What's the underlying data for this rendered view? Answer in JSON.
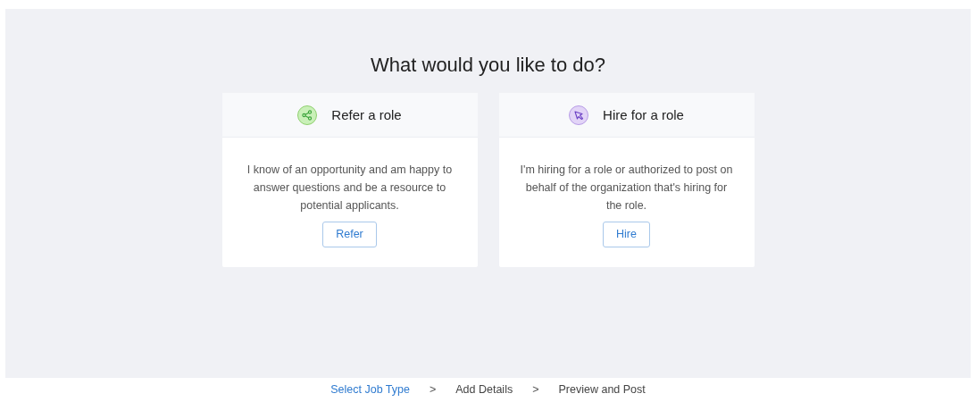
{
  "heading": "What would you like to do?",
  "options": [
    {
      "kind": "share",
      "title": "Refer a role",
      "description": "I know of an opportunity and am happy to answer questions and be a resource to potential applicants.",
      "button": "Refer",
      "color": "#c9f0b8"
    },
    {
      "kind": "pin",
      "title": "Hire for a role",
      "description": "I'm hiring for a role or authorized to post on behalf of the organization that's hiring for the role.",
      "button": "Hire",
      "color": "#e2d4f7"
    }
  ],
  "steps": [
    {
      "label": "Select Job Type",
      "selected": true
    },
    {
      "label": "Add Details",
      "selected": false
    },
    {
      "label": "Preview and Post",
      "selected": false
    }
  ],
  "step_separator": ">"
}
